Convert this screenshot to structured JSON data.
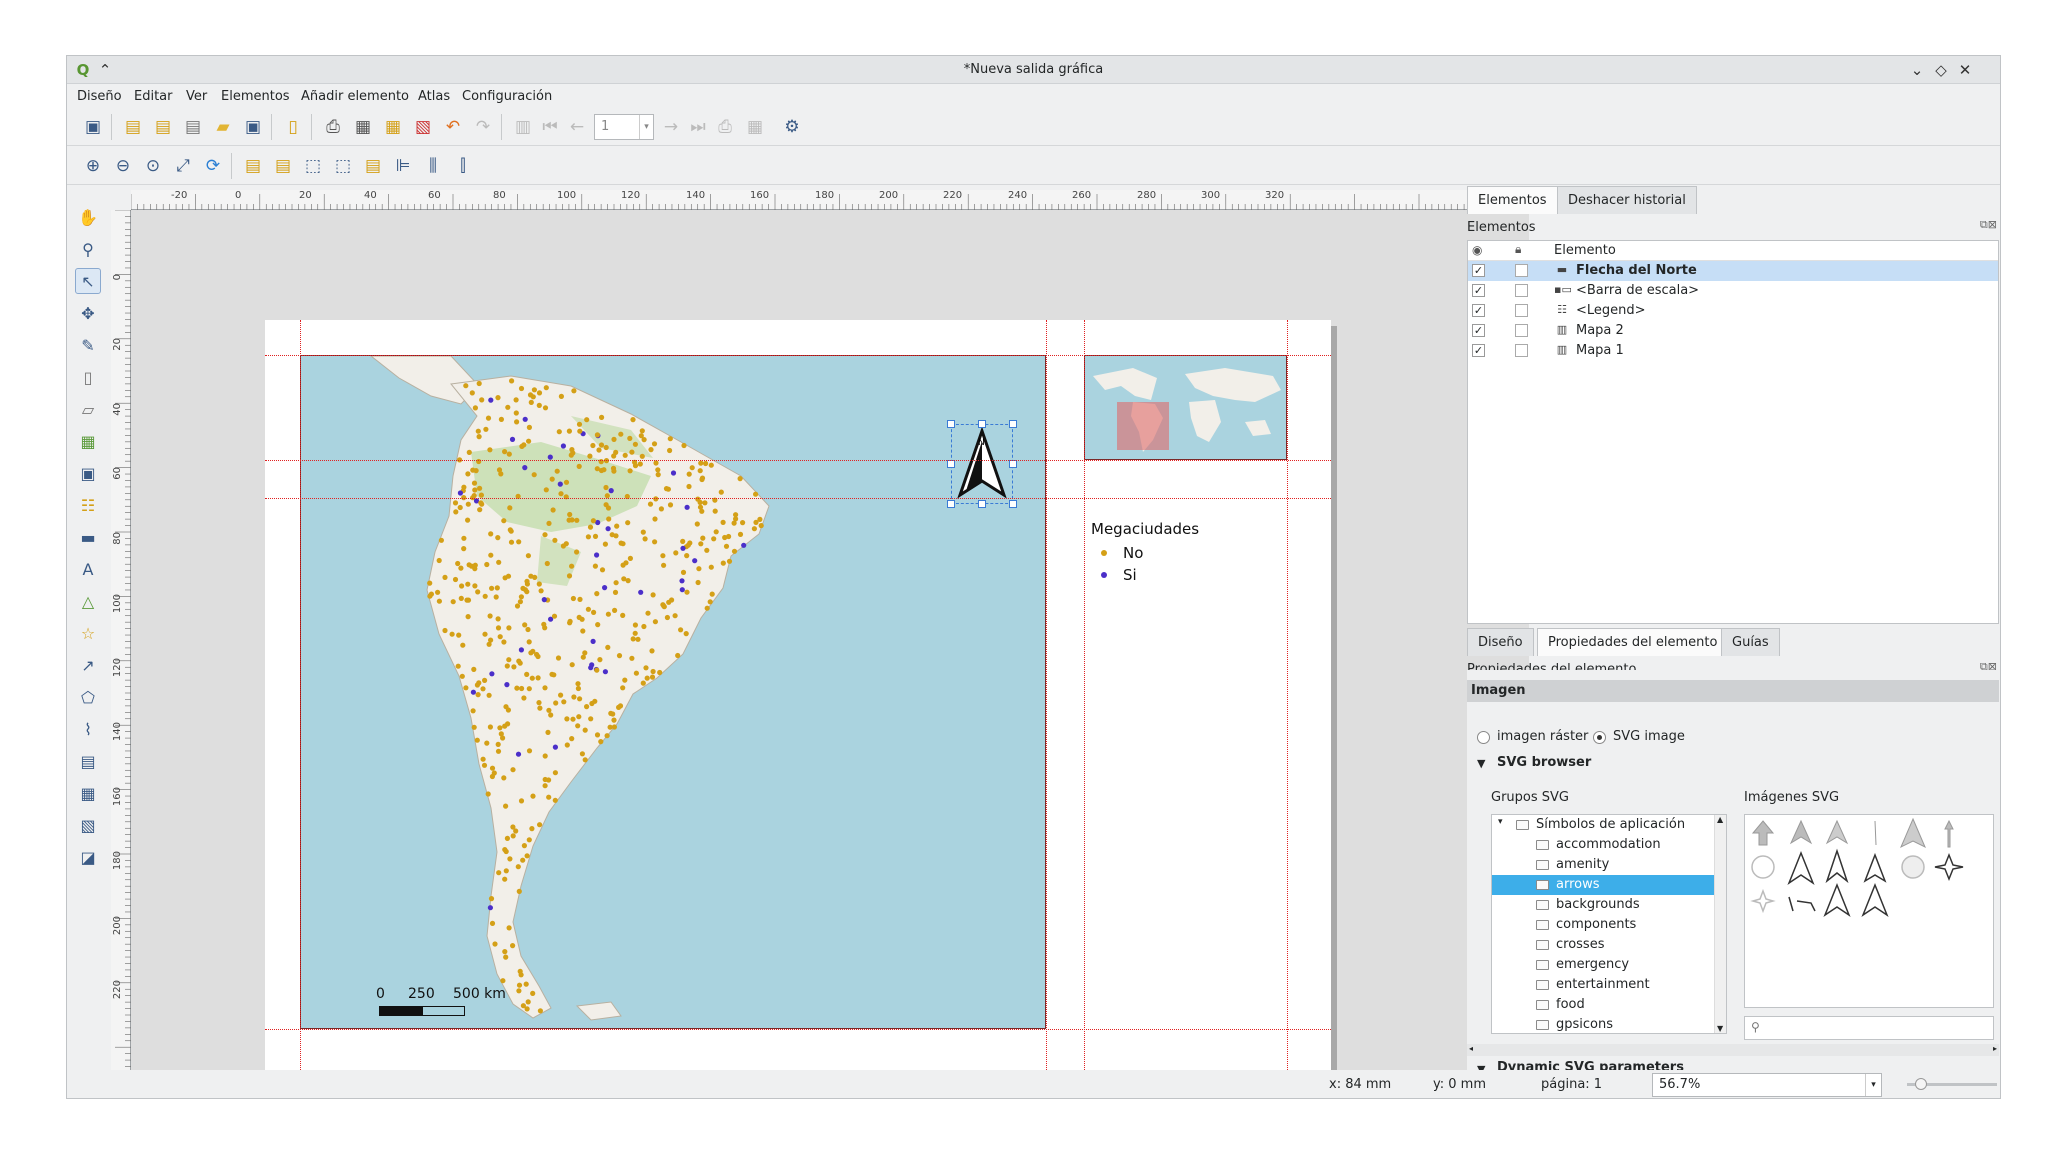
{
  "window": {
    "title": "*Nueva salida gráfica",
    "controls": [
      "chevron-down-icon",
      "restore-icon",
      "close-icon"
    ]
  },
  "menu": [
    "Diseño",
    "Editar",
    "Ver",
    "Elementos",
    "Añadir elemento",
    "Atlas",
    "Configuración"
  ],
  "toolbar": {
    "page_value": "1"
  },
  "ruler": {
    "h_labels": [
      "-20",
      "0",
      "20",
      "40",
      "60",
      "80",
      "100",
      "120",
      "140",
      "160",
      "180",
      "200",
      "220",
      "240",
      "260",
      "280",
      "300",
      "320"
    ],
    "v_labels": [
      "0",
      "20",
      "40",
      "60",
      "80",
      "100",
      "120",
      "140",
      "160",
      "180",
      "200",
      "220"
    ]
  },
  "layout": {
    "legend": {
      "title": "Megaciudades",
      "items": [
        {
          "label": "No",
          "color": "#d4a017"
        },
        {
          "label": "Si",
          "color": "#4b2fc9"
        }
      ]
    },
    "scalebar": {
      "labels": [
        "0",
        "250",
        "500 km"
      ]
    }
  },
  "right_panel": {
    "top_tabs": [
      "Elementos",
      "Deshacer historial"
    ],
    "elements_header": "Elementos",
    "column_header": "Elemento",
    "elements": [
      {
        "name": "Flecha del Norte",
        "checked": true,
        "selected": true,
        "icon": "image-icon"
      },
      {
        "name": "<Barra de escala>",
        "checked": true,
        "selected": false,
        "icon": "scalebar-icon"
      },
      {
        "name": "<Legend>",
        "checked": true,
        "selected": false,
        "icon": "legend-icon"
      },
      {
        "name": "Mapa 2",
        "checked": true,
        "selected": false,
        "icon": "map-icon"
      },
      {
        "name": "Mapa 1",
        "checked": true,
        "selected": false,
        "icon": "map-icon"
      }
    ],
    "bottom_tabs": [
      "Diseño",
      "Propiedades del elemento",
      "Guías"
    ],
    "props_header": "Propiedades del elemento",
    "section_title": "Imagen",
    "radio_raster": "imagen ráster",
    "radio_svg": "SVG image",
    "svg_browser": "SVG browser",
    "svg_groups_label": "Grupos SVG",
    "svg_images_label": "Imágenes SVG",
    "groups": [
      {
        "name": "Símbolos de aplicación",
        "root": true,
        "selected": false
      },
      {
        "name": "accommodation",
        "root": false,
        "selected": false
      },
      {
        "name": "amenity",
        "root": false,
        "selected": false
      },
      {
        "name": "arrows",
        "root": false,
        "selected": true
      },
      {
        "name": "backgrounds",
        "root": false,
        "selected": false
      },
      {
        "name": "components",
        "root": false,
        "selected": false
      },
      {
        "name": "crosses",
        "root": false,
        "selected": false
      },
      {
        "name": "emergency",
        "root": false,
        "selected": false
      },
      {
        "name": "entertainment",
        "root": false,
        "selected": false
      },
      {
        "name": "food",
        "root": false,
        "selected": false
      },
      {
        "name": "gpsicons",
        "root": false,
        "selected": false
      }
    ],
    "dynamic_section": "Dynamic SVG parameters"
  },
  "status": {
    "x": "x: 84 mm",
    "y": "y: 0 mm",
    "page": "página: 1",
    "zoom": "56.7%"
  },
  "colors": {
    "accent": "#3daee9",
    "sea": "#aad3df",
    "land": "#f2efe9",
    "city_no": "#d4a017",
    "city_si": "#4b2fc9"
  }
}
